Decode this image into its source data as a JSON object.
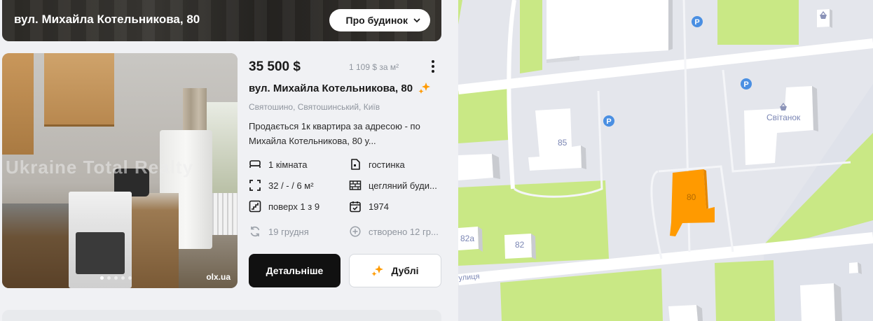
{
  "header": {
    "title": "вул. Михайла Котельникова, 80",
    "about_button": "Про будинок"
  },
  "listing": {
    "price": "35 500 $",
    "price_per_m2": "1 109 $ за м²",
    "address": "вул. Михайла Котельникова, 80",
    "district": "Святошино, Святошинський, Київ",
    "description": "Продається 1к квартира за адресою - по Михайла Котельникова, 80 у...",
    "photo": {
      "watermark": "Ukraine Total Realty",
      "source": "olx.ua",
      "slides": 5,
      "active_slide": 1
    },
    "features": {
      "rooms": "1 кімната",
      "type": "гостинка",
      "area": "32 / - / 6 м²",
      "material": "цегляний буди...",
      "floor": "поверх 1 з 9",
      "year": "1974",
      "updated": "19 грудня",
      "created": "створено 12 гр..."
    },
    "buttons": {
      "details": "Детальніше",
      "duplicates": "Дублі"
    }
  },
  "map": {
    "labels": {
      "building_85": "85",
      "building_80": "80",
      "building_82": "82",
      "building_82a": "82а",
      "svitanok": "Світанок",
      "street_fragment": "улиця"
    },
    "colors": {
      "highlight": "#ff9a00",
      "green": "#c9e885",
      "parking": "#4a8fe2"
    }
  },
  "theme": {
    "accent": "#ff9a00",
    "text": "#1a1a1a",
    "muted": "#8f959e"
  }
}
